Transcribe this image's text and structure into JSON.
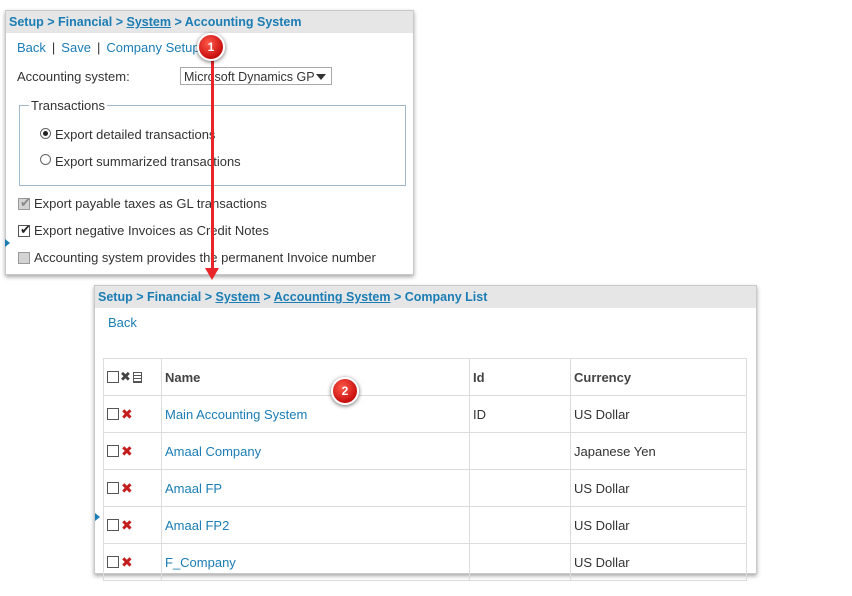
{
  "panel1": {
    "breadcrumb": {
      "setup": "Setup",
      "financial": "Financial",
      "system": "System",
      "current": "Accounting System"
    },
    "toolbar": {
      "back": "Back",
      "save": "Save",
      "company_setup": "Company Setup"
    },
    "accounting_system_label": "Accounting system:",
    "accounting_system_value": "Microsoft Dynamics GP",
    "transactions": {
      "legend": "Transactions",
      "option_detailed": "Export detailed transactions",
      "option_summarized": "Export summarized transactions",
      "selected": "detailed"
    },
    "checkboxes": {
      "payable_taxes": "Export payable taxes as GL transactions",
      "negative_invoices": "Export negative Invoices as Credit Notes",
      "permanent_invoice": "Accounting system provides the permanent Invoice number"
    }
  },
  "panel2": {
    "breadcrumb": {
      "setup": "Setup",
      "financial": "Financial",
      "system": "System",
      "accounting_system": "Accounting System",
      "current": "Company List"
    },
    "toolbar": {
      "back": "Back"
    },
    "columns": {
      "name": "Name",
      "id": "Id",
      "currency": "Currency"
    },
    "rows": [
      {
        "name": "Main Accounting System",
        "id": "ID",
        "currency": "US Dollar"
      },
      {
        "name": "Amaal Company",
        "id": "",
        "currency": "Japanese Yen"
      },
      {
        "name": "Amaal FP",
        "id": "",
        "currency": "US Dollar"
      },
      {
        "name": "Amaal FP2",
        "id": "",
        "currency": "US Dollar"
      },
      {
        "name": "F_Company",
        "id": "",
        "currency": "US Dollar"
      }
    ]
  },
  "annotations": {
    "step1": "1",
    "step2": "2"
  },
  "colors": {
    "link": "#1a7db5",
    "accent_red": "#e8262a",
    "delete_red": "#c41d1d"
  }
}
